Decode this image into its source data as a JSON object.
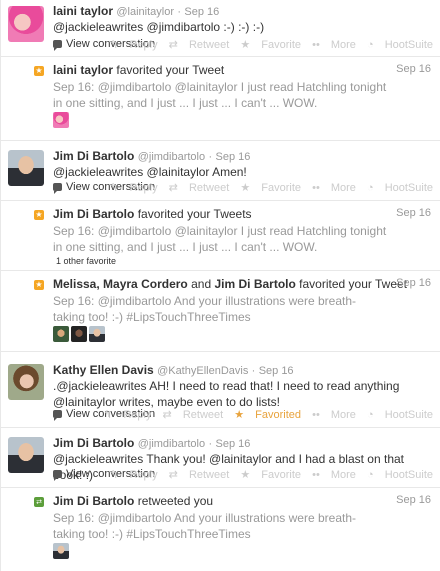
{
  "tweets": [
    {
      "name": "laini taylor",
      "handle": "@lainitaylor",
      "time": "Sep 16",
      "text": "@jackieleawrites @jimdibartolo :-) :-) :-)",
      "view_conversation": "View conversation",
      "favorited": false
    },
    {
      "name": "Jim Di Bartolo",
      "handle": "@jimdibartolo",
      "time": "Sep 16",
      "text": "@jackieleawrites @lainitaylor Amen!",
      "view_conversation": "View conversation",
      "favorited": false
    },
    {
      "name": "Kathy Ellen Davis",
      "handle": "@KathyEllenDavis",
      "time": "Sep 16",
      "text": ".@jackieleawrites AH! I need to read that! I need to read anything @lainitaylor writes, maybe even to do lists!",
      "view_conversation": "View conversation",
      "favorited": true
    },
    {
      "name": "Jim Di Bartolo",
      "handle": "@jimdibartolo",
      "time": "Sep 16",
      "text": "@jackieleawrites Thank you! @lainitaylor and I had a blast on that book! :)",
      "view_conversation": "View conversation",
      "favorited": false
    }
  ],
  "actions": {
    "reply": "Reply",
    "retweet": "Retweet",
    "favorite": "Favorite",
    "favorited": "Favorited",
    "more": "More",
    "hootsuite": "HootSuite"
  },
  "activities": [
    {
      "actor": "laini taylor",
      "verb": "favorited your Tweet",
      "time": "Sep 16",
      "text": "Sep 16: @jimdibartolo @lainitaylor I just read Hatchling tonight in one sitting, and I just ... I just ... I can't ... WOW."
    },
    {
      "actor": "Jim Di Bartolo",
      "verb": "favorited your Tweets",
      "time": "Sep 16",
      "text": "Sep 16: @jimdibartolo @lainitaylor I just read Hatchling tonight in one sitting, and I just ... I just ... I can't ... WOW.",
      "note": "1 other favorite"
    },
    {
      "actor_a": "Melissa",
      "actor_b": "Mayra Cordero",
      "joiner": "and",
      "actor_c": "Jim Di Bartolo",
      "verb": "favorited your Tweet",
      "time": "Sep 16",
      "text": "Sep 16: @jimdibartolo And your illustrations were breath-taking too! :-) #LipsTouchThreeTimes"
    },
    {
      "actor": "Jim Di Bartolo",
      "verb": "retweeted you",
      "time": "Sep 16",
      "text": "Sep 16: @jimdibartolo And your illustrations were breath-taking too! :-) #LipsTouchThreeTimes"
    }
  ],
  "icons": {
    "favorite": "star-icon",
    "retweet": "retweet-icon",
    "conversation": "speech-bubble-icon"
  },
  "colors": {
    "favorite_accent": "#f5a623",
    "retweet_accent": "#5c9e3b",
    "muted": "#999999",
    "divider": "#e8e8e8"
  }
}
